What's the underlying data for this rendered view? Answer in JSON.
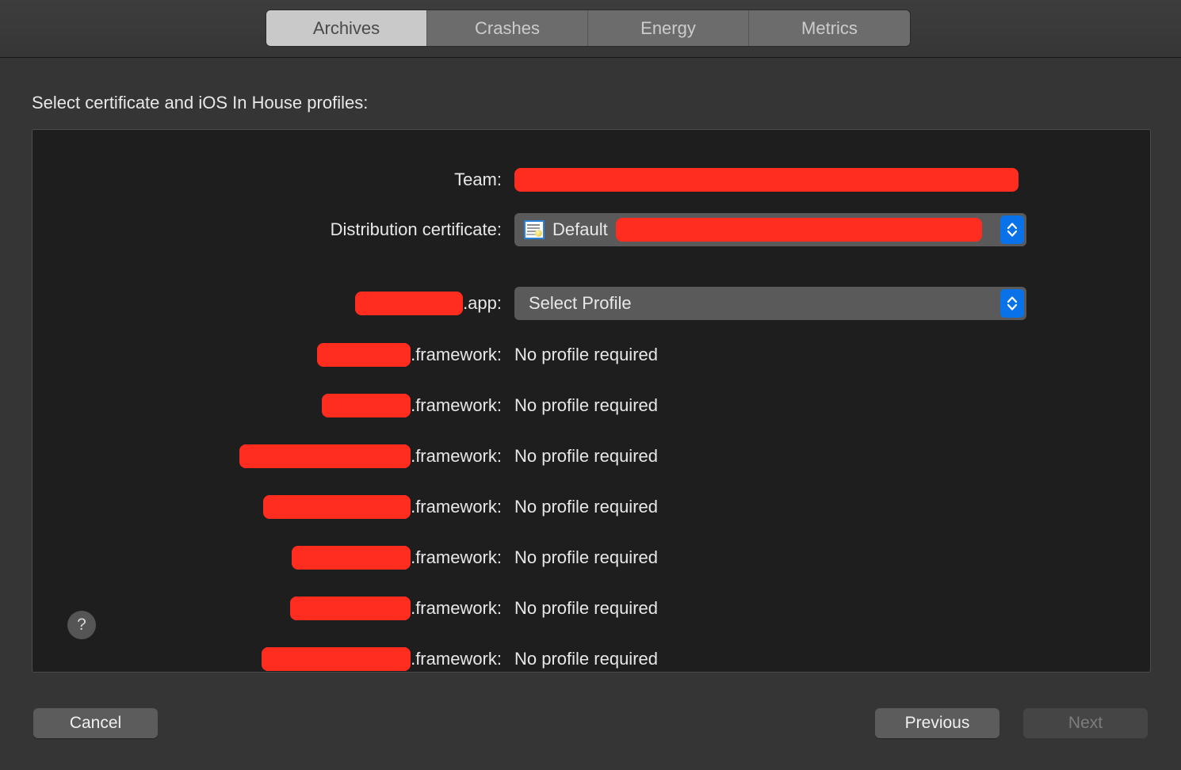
{
  "toolbar": {
    "tabs": [
      {
        "label": "Archives",
        "active": true
      },
      {
        "label": "Crashes",
        "active": false
      },
      {
        "label": "Energy",
        "active": false
      },
      {
        "label": "Metrics",
        "active": false
      }
    ]
  },
  "heading": "Select certificate and iOS In House profiles:",
  "form": {
    "team": {
      "label": "Team:",
      "value_redacted": true,
      "redaction_width": 636
    },
    "certificate": {
      "label": "Distribution certificate:",
      "icon": "certificate-icon",
      "value": "Default",
      "redaction_width": 462,
      "stepper_icon": "chevron-up-down-icon"
    },
    "app": {
      "label_redaction_width": 136,
      "label_suffix": ".app:",
      "value": "Select Profile",
      "stepper_icon": "chevron-up-down-icon"
    },
    "frameworks": [
      {
        "label_redaction_width": 118,
        "label_suffix": ".framework:",
        "value": "No profile required"
      },
      {
        "label_redaction_width": 112,
        "label_suffix": ".framework:",
        "value": "No profile required"
      },
      {
        "label_redaction_width": 216,
        "label_suffix": ".framework:",
        "value": "No profile required"
      },
      {
        "label_redaction_width": 186,
        "label_suffix": ".framework:",
        "value": "No profile required"
      },
      {
        "label_redaction_width": 150,
        "label_suffix": ".framework:",
        "value": "No profile required"
      },
      {
        "label_redaction_width": 152,
        "label_suffix": ".framework:",
        "value": "No profile required"
      },
      {
        "label_redaction_width": 188,
        "label_suffix": ".framework:",
        "value": "No profile required"
      }
    ]
  },
  "help_button": {
    "glyph": "?"
  },
  "footer": {
    "cancel": "Cancel",
    "previous": "Previous",
    "next": "Next",
    "next_disabled": true
  },
  "colors": {
    "window_background": "#353535",
    "panel_background": "#1e1e1e",
    "redaction": "#ff2d1f",
    "accent_blue": "#0a72e8",
    "text_primary": "#e8e8e8"
  }
}
